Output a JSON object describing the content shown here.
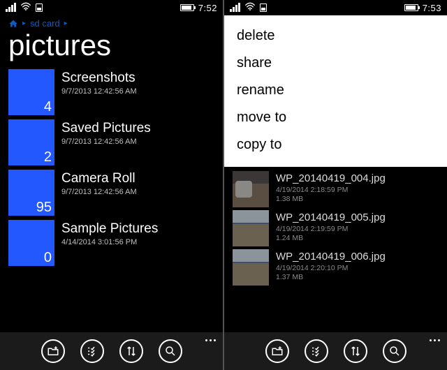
{
  "left": {
    "status": {
      "time": "7:52"
    },
    "breadcrumb": {
      "crumb1": "sd card"
    },
    "title": "pictures",
    "folders": [
      {
        "name": "Screenshots",
        "date": "9/7/2013 12:42:56 AM",
        "count": "4"
      },
      {
        "name": "Saved Pictures",
        "date": "9/7/2013 12:42:56 AM",
        "count": "2"
      },
      {
        "name": "Camera Roll",
        "date": "9/7/2013 12:42:56 AM",
        "count": "95"
      },
      {
        "name": "Sample Pictures",
        "date": "4/14/2014 3:01:56 PM",
        "count": "0"
      }
    ]
  },
  "right": {
    "status": {
      "time": "7:53"
    },
    "menu": {
      "delete": "delete",
      "share": "share",
      "rename": "rename",
      "moveto": "move to",
      "copyto": "copy to"
    },
    "files": [
      {
        "name": "WP_20140419_004.jpg",
        "date": "4/19/2014 2:18:59 PM",
        "size": "1.38 MB"
      },
      {
        "name": "WP_20140419_005.jpg",
        "date": "4/19/2014 2:19:59 PM",
        "size": "1.24 MB"
      },
      {
        "name": "WP_20140419_006.jpg",
        "date": "4/19/2014 2:20:10 PM",
        "size": "1.37 MB"
      }
    ]
  }
}
